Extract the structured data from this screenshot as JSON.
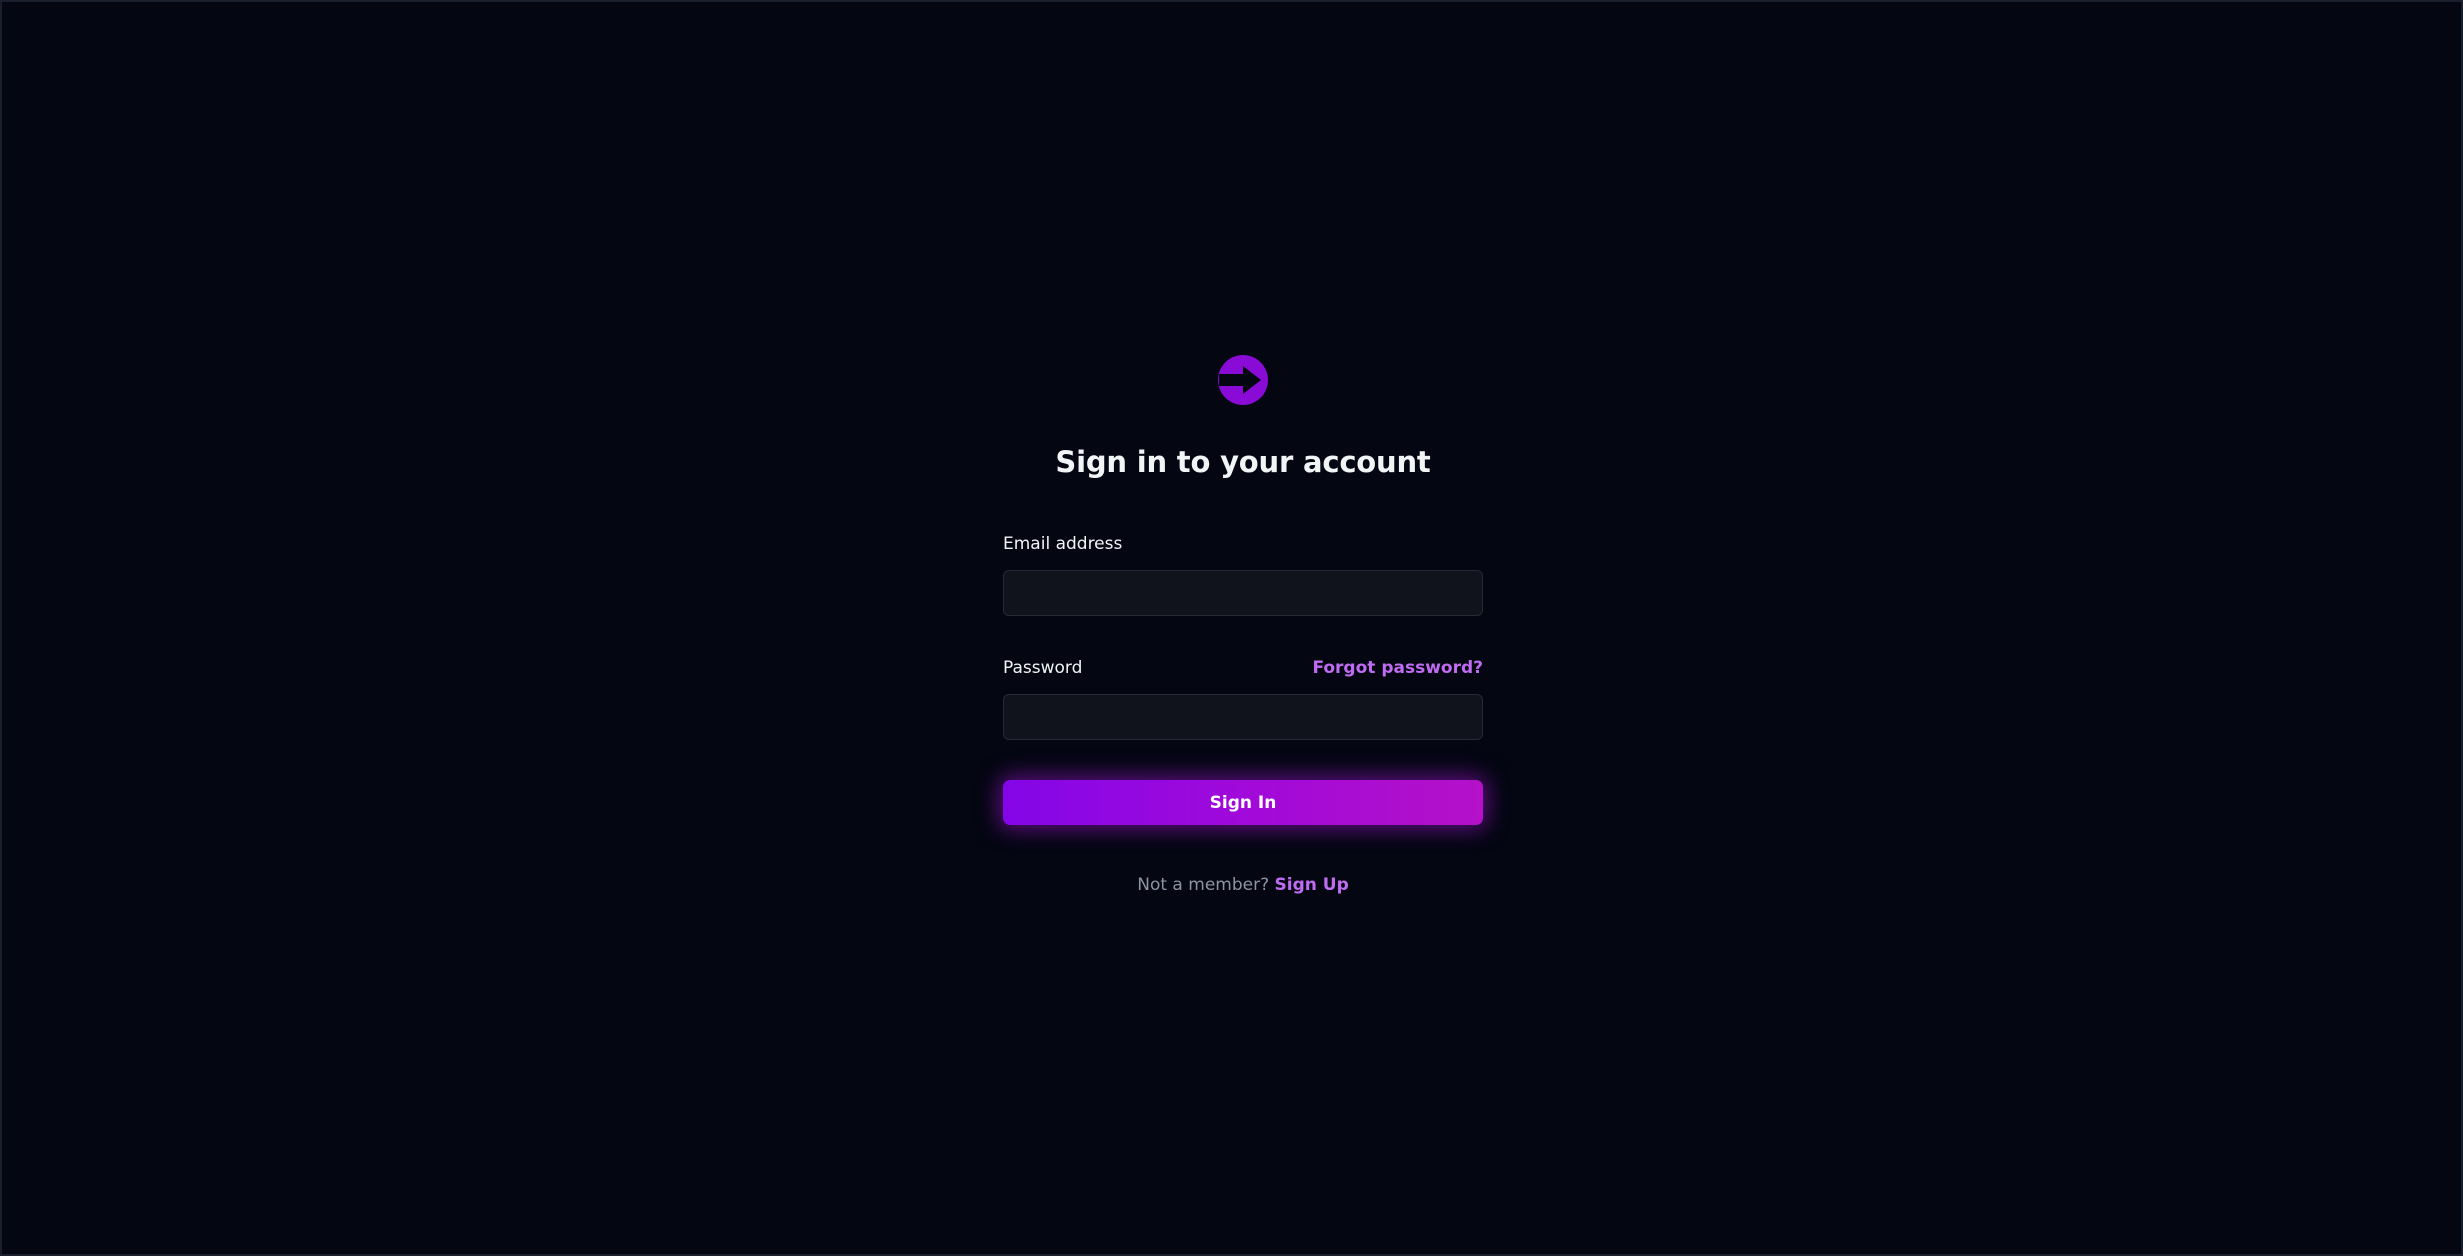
{
  "logo": {
    "icon": "arrow-circle-icon",
    "color": "#8a0ad6"
  },
  "heading": "Sign in to your account",
  "email": {
    "label": "Email address",
    "value": "",
    "placeholder": ""
  },
  "password": {
    "label": "Password",
    "value": "",
    "placeholder": "",
    "forgot_link": "Forgot password?"
  },
  "sign_in_button": "Sign In",
  "footer": {
    "prompt": "Not a member?",
    "signup_link": "Sign Up"
  },
  "colors": {
    "background": "#040612",
    "accent": "#c06cf2",
    "button_start": "#8406e8",
    "button_end": "#b411c8",
    "input_bg": "#11131c"
  }
}
